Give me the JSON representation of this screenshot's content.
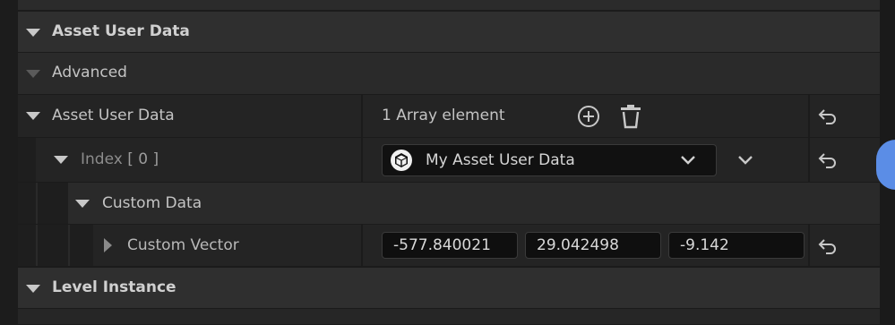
{
  "sections": {
    "asset_user_data_category": "Asset User Data",
    "advanced": "Advanced",
    "level_instance": "Level Instance"
  },
  "array_row": {
    "label": "Asset User Data",
    "summary": "1 Array element"
  },
  "index_row": {
    "label_prefix": "Index",
    "label_index": "[ 0 ]",
    "selected_value": "My Asset User Data"
  },
  "custom_data": {
    "label": "Custom Data"
  },
  "custom_vector": {
    "label": "Custom Vector",
    "x": "-577.840021",
    "y": "29.042498",
    "z": "-9.142"
  },
  "icons": [
    "add-circle-icon",
    "trash-icon",
    "reset-arrow-icon",
    "cube-icon",
    "chevron-down-icon",
    "expand-arrow-icon",
    "collapse-arrow-icon"
  ],
  "colors": {
    "background": "#242424",
    "category": "#2f2f2f",
    "field": "#0f0f0f",
    "accent": "#5b8de6"
  }
}
